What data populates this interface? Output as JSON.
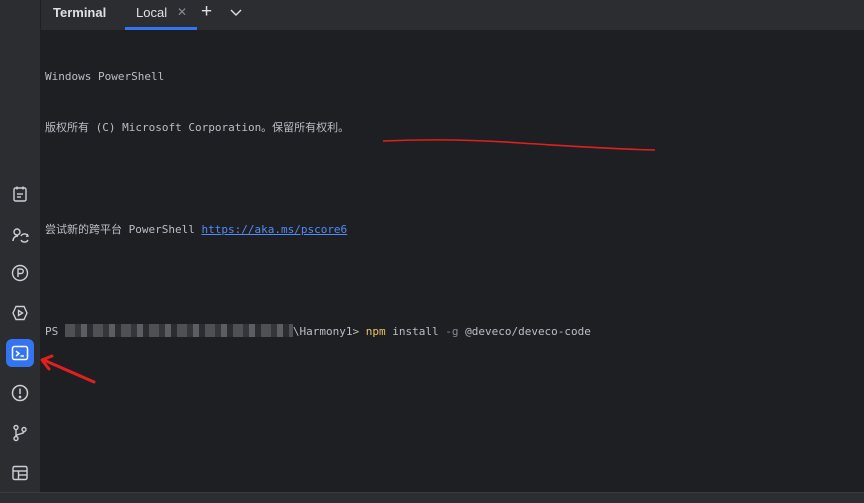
{
  "tabbar": {
    "title": "Terminal",
    "tab_label": "Local",
    "close_glyph": "✕",
    "add_glyph": "+"
  },
  "terminal": {
    "line1": "Windows PowerShell",
    "line2": "版权所有 (C) Microsoft Corporation。保留所有权利。",
    "line3_prefix": "尝试新的跨平台 PowerShell ",
    "line3_link": "https://aka.ms/pscore6",
    "prompt_start": "PS ",
    "prompt_end": "\\Harmony1> ",
    "cmd_npm": "npm",
    "cmd_install": " install ",
    "cmd_flag": "-g",
    "cmd_pkg": " @deveco/deveco-code"
  },
  "sidebar": {
    "tools": [
      "project-icon",
      "sync-icon",
      "p-icon",
      "run-icon",
      "terminal-icon",
      "problems-icon",
      "git-icon",
      "layout-icon"
    ],
    "active": "terminal-icon"
  },
  "colors": {
    "accent": "#3574f0",
    "annotation_red": "#e0201e",
    "command_yellow": "#e8c46a",
    "link_blue": "#548af7"
  }
}
